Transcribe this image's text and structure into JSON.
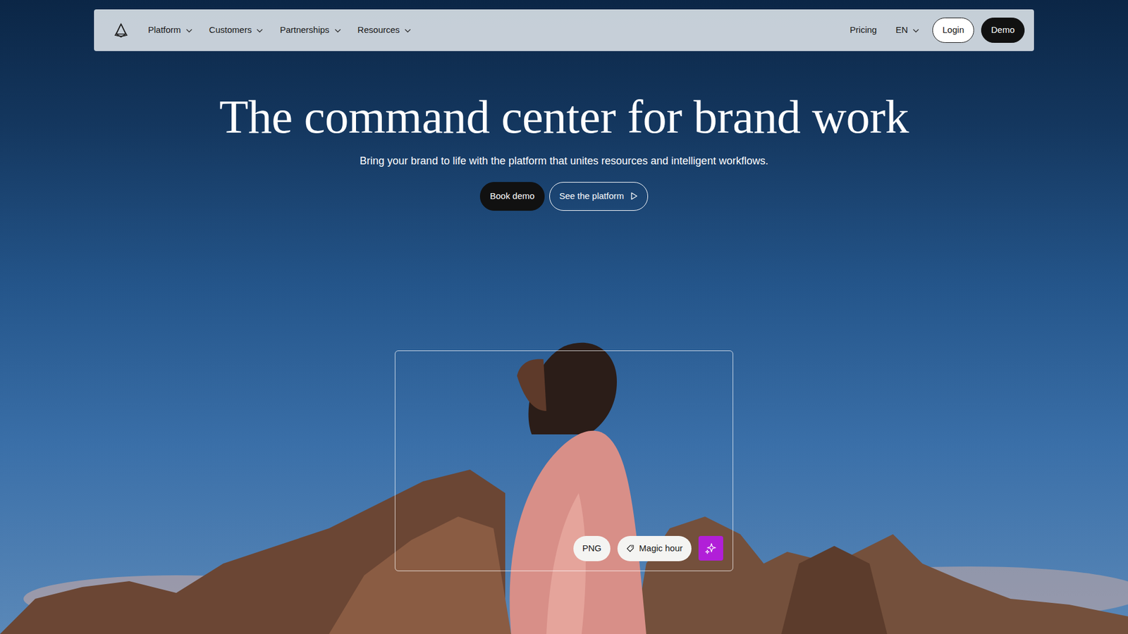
{
  "nav": {
    "items": [
      {
        "label": "Platform"
      },
      {
        "label": "Customers"
      },
      {
        "label": "Partnerships"
      },
      {
        "label": "Resources"
      }
    ],
    "pricing": "Pricing",
    "language": "EN",
    "login": "Login",
    "demo": "Demo"
  },
  "hero": {
    "title": "The command center for brand work",
    "subtitle": "Bring your brand to life with the platform that unites resources and intelligent workflows.",
    "buttons": [
      {
        "label": "Book demo",
        "kind": "primary"
      },
      {
        "label": "See the platform",
        "kind": "outline"
      }
    ]
  },
  "asset_card": {
    "tags": [
      {
        "label": "PNG",
        "kind": "plain"
      },
      {
        "label": "Magic hour",
        "kind": "tag"
      }
    ]
  }
}
